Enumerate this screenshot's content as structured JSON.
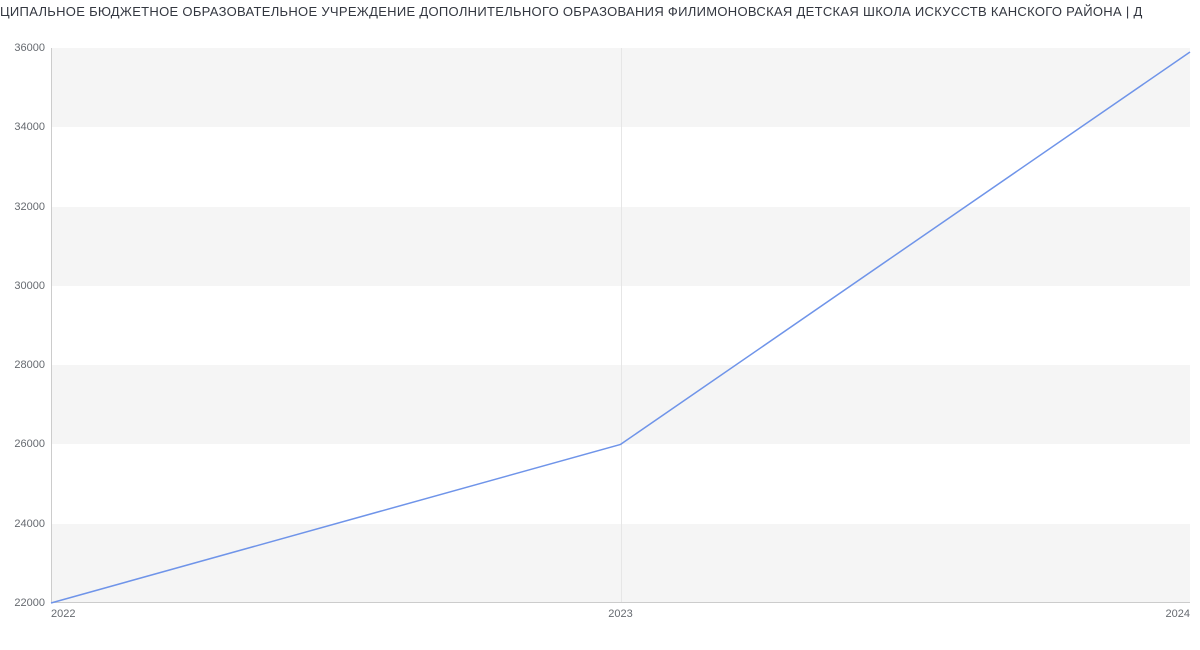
{
  "chart_data": {
    "type": "line",
    "title": "ЦИПАЛЬНОЕ БЮДЖЕТНОЕ ОБРАЗОВАТЕЛЬНОЕ УЧРЕЖДЕНИЕ ДОПОЛНИТЕЛЬНОГО ОБРАЗОВАНИЯ ФИЛИМОНОВСКАЯ ДЕТСКАЯ ШКОЛА ИСКУССТВ КАНСКОГО РАЙОНА | Д",
    "x": [
      2022,
      2023,
      2024
    ],
    "values": [
      22000,
      26000,
      35900
    ],
    "xlabel": "",
    "ylabel": "",
    "ylim": [
      22000,
      36000
    ],
    "xlim": [
      2022,
      2024
    ],
    "y_ticks": [
      22000,
      24000,
      26000,
      28000,
      30000,
      32000,
      34000,
      36000
    ],
    "x_ticks": [
      "2022",
      "2023",
      "2024"
    ],
    "line_color": "#6f94e9"
  }
}
